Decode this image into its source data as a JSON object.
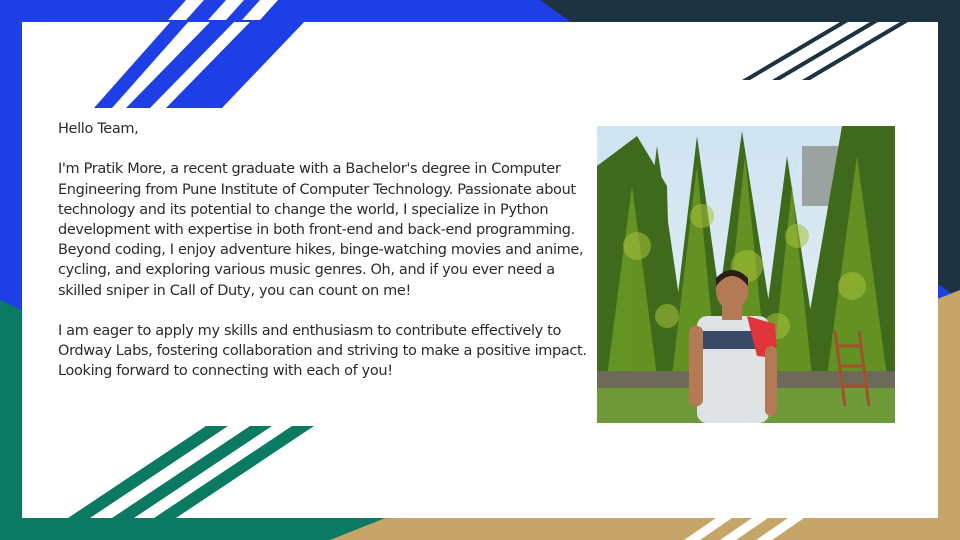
{
  "slide": {
    "greeting": "Hello Team,",
    "paragraph1": "I'm Pratik More, a recent graduate with a Bachelor's degree in Computer Engineering from Pune Institute of Computer Technology. Passionate about technology and its potential to change the world, I specialize in Python development with expertise in both front-end and back-end programming. Beyond coding, I enjoy adventure hikes, binge-watching movies and anime, cycling, and exploring various music genres.  Oh, and if you ever need a skilled sniper in Call of Duty, you can count on me!",
    "paragraph2": "I am eager to apply my skills and enthusiasm to contribute effectively to Ordway Labs, fostering collaboration and striving to make a positive impact. Looking forward to connecting with each of you!",
    "photo_icon": "profile-photo"
  },
  "colors": {
    "blue": "#1e3ee6",
    "dark_navy": "#1d3340",
    "teal": "#0b7a63",
    "gold": "#c6a569",
    "card": "#ffffff",
    "text": "#2b2b2b"
  }
}
